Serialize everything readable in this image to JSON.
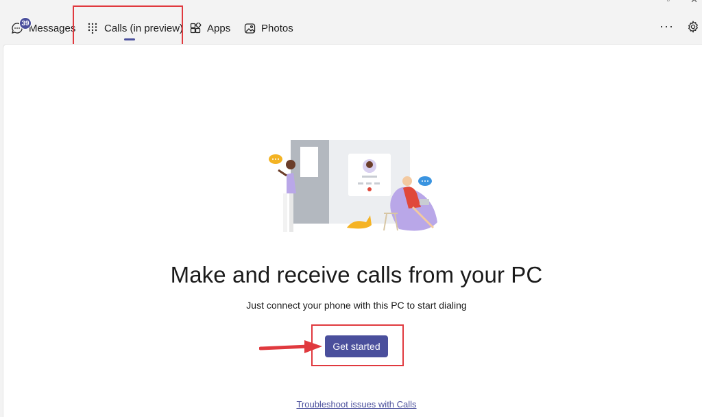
{
  "nav": {
    "tabs": [
      {
        "label": "Messages",
        "icon": "chat-icon",
        "badge": "39"
      },
      {
        "label": "Calls (in preview)",
        "icon": "dialpad-icon",
        "active": true
      },
      {
        "label": "Apps",
        "icon": "apps-icon"
      },
      {
        "label": "Photos",
        "icon": "photos-icon"
      }
    ],
    "more_label": "···",
    "settings_icon": "gear-icon"
  },
  "main": {
    "headline": "Make and receive calls from your PC",
    "subtext": "Just connect your phone with this PC to start dialing",
    "primary_button": "Get started",
    "link": "Troubleshoot issues with Calls"
  },
  "colors": {
    "accent": "#4a4f9c",
    "annotation_red": "#e0393e",
    "panel_bg": "#ffffff",
    "window_bg": "#f3f3f3"
  }
}
